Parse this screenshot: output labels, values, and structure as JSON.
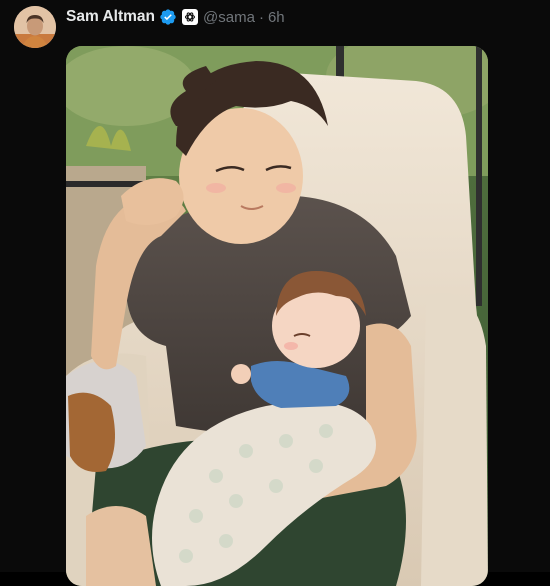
{
  "post": {
    "author_name": "Sam Altman",
    "handle": "@sama",
    "separator": "·",
    "timestamp": "6h"
  },
  "icons": {
    "verified": "verified-badge-icon",
    "affiliation": "openai-affiliation-icon"
  },
  "colors": {
    "background": "#000000",
    "name_text": "#e7e9ea",
    "muted_text": "#71767b",
    "verified_blue": "#1d9bf0"
  },
  "media": {
    "alt": "Anime-style illustration of a man sleeping in an armchair while holding a sleeping swaddled baby"
  }
}
